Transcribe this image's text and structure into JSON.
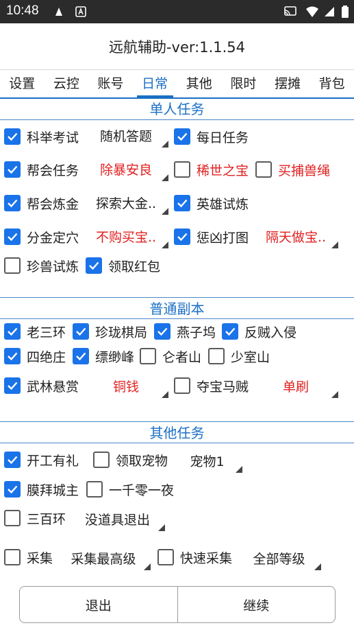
{
  "status": {
    "time": "10:48"
  },
  "title": "远航辅助-ver:1.1.54",
  "tabs": [
    "设置",
    "云控",
    "账号",
    "日常",
    "其他",
    "限时",
    "摆摊",
    "背包"
  ],
  "active_tab": "日常",
  "sections": {
    "single": "单人任务",
    "dungeon": "普通副本",
    "other": "其他任务"
  },
  "single": {
    "keju": {
      "label": "科举考试",
      "checked": true,
      "option": "随机答题"
    },
    "meiri": {
      "label": "每日任务",
      "checked": true
    },
    "banghui": {
      "label": "帮会任务",
      "checked": true,
      "option": "除暴安良"
    },
    "xishi": {
      "label": "稀世之宝",
      "checked": false
    },
    "maibu": {
      "label": "买捕兽绳",
      "checked": false
    },
    "lianjin": {
      "label": "帮会炼金",
      "checked": true,
      "option": "探索大金.."
    },
    "yingxiong": {
      "label": "英雄试炼",
      "checked": true
    },
    "fenjin": {
      "label": "分金定穴",
      "checked": true,
      "option": "不购买宝.."
    },
    "chengxiong": {
      "label": "惩凶打图",
      "checked": true,
      "option": "隔天做宝.."
    },
    "zhenshou": {
      "label": "珍兽试炼",
      "checked": false
    },
    "hongbao": {
      "label": "领取红包",
      "checked": true
    }
  },
  "dungeon": {
    "laosanhuan": {
      "label": "老三环",
      "checked": true
    },
    "linglong": {
      "label": "珍珑棋局",
      "checked": true
    },
    "yanziwu": {
      "label": "燕子坞",
      "checked": true
    },
    "fanzei": {
      "label": "反贼入侵",
      "checked": true
    },
    "sijue": {
      "label": "四绝庄",
      "checked": true
    },
    "piaomiao": {
      "label": "缥缈峰",
      "checked": true
    },
    "lunzhe": {
      "label": "仑者山",
      "checked": false
    },
    "shaoshi": {
      "label": "少室山",
      "checked": false
    },
    "wulin": {
      "label": "武林悬赏",
      "checked": true,
      "option": "铜钱"
    },
    "duobao": {
      "label": "夺宝马贼",
      "checked": false,
      "option": "单刷"
    }
  },
  "other": {
    "kaigong": {
      "label": "开工有礼",
      "checked": true
    },
    "chongwu": {
      "label": "领取宠物",
      "checked": false,
      "option": "宠物1"
    },
    "mobai": {
      "label": "膜拜城主",
      "checked": true
    },
    "yiqian": {
      "label": "一千零一夜",
      "checked": false
    },
    "sanbai": {
      "label": "三百环",
      "checked": false,
      "option": "没道具退出"
    },
    "caiji": {
      "label": "采集",
      "checked": false,
      "option": "采集最高级"
    },
    "kuaisu": {
      "label": "快速采集",
      "checked": false,
      "option": "全部等级"
    }
  },
  "buttons": {
    "exit": "退出",
    "continue": "继续"
  },
  "colors": {
    "accent": "#1a6fc4",
    "checkbox_on": "#1a73e8",
    "option_red": "#e02020"
  }
}
